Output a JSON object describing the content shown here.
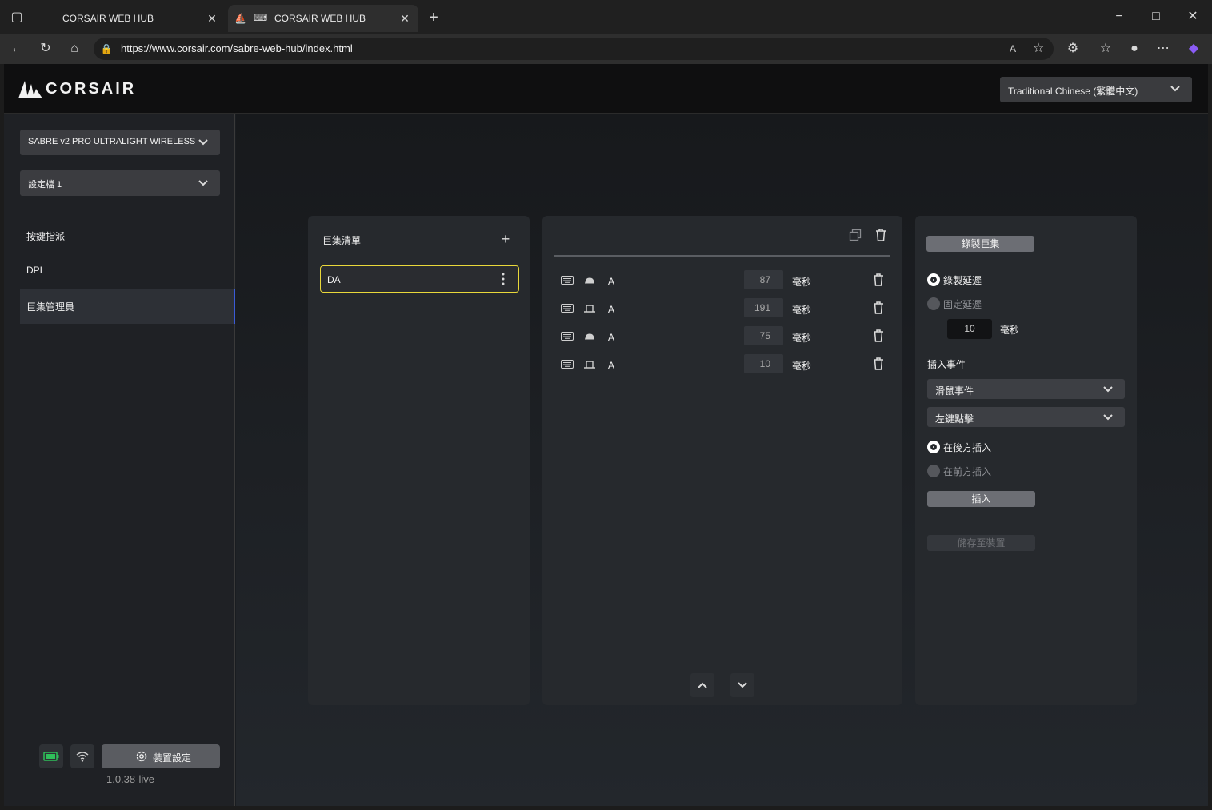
{
  "browser": {
    "tabs": [
      {
        "title": "CORSAIR WEB HUB"
      },
      {
        "title": "CORSAIR WEB HUB"
      }
    ],
    "url": "https://www.corsair.com/sabre-web-hub/index.html"
  },
  "header": {
    "brand": "CORSAIR",
    "language": "Traditional Chinese (繁體中文)"
  },
  "sidebar": {
    "device": "SABRE v2 PRO ULTRALIGHT WIRELESS",
    "profile": "設定檔 1",
    "nav": [
      {
        "label": "按鍵指派"
      },
      {
        "label": "DPI"
      },
      {
        "label": "巨集管理員"
      }
    ],
    "device_settings_label": "裝置設定",
    "version": "1.0.38-live"
  },
  "macro_list": {
    "title": "巨集清單",
    "items": [
      {
        "name": "DA"
      }
    ]
  },
  "events": {
    "rows": [
      {
        "key": "A",
        "action": "press",
        "delay": "87",
        "unit": "毫秒"
      },
      {
        "key": "A",
        "action": "release",
        "delay": "191",
        "unit": "毫秒"
      },
      {
        "key": "A",
        "action": "press",
        "delay": "75",
        "unit": "毫秒"
      },
      {
        "key": "A",
        "action": "release",
        "delay": "10",
        "unit": "毫秒"
      }
    ]
  },
  "settings": {
    "record_button": "錄製巨集",
    "record_delay_label": "錄製延遲",
    "fixed_delay_label": "固定延遲",
    "fixed_delay_value": "10",
    "fixed_delay_unit": "毫秒",
    "insert_event_title": "插入事件",
    "event_type": "滑鼠事件",
    "event_value": "左鍵點擊",
    "insert_after_label": "在後方插入",
    "insert_before_label": "在前方插入",
    "insert_button": "插入",
    "save_button": "儲存至裝置"
  },
  "colors": {
    "accent_selected": "#e9d83a",
    "nav_active_bar": "#3b5bd6",
    "battery_green": "#2fbf5a"
  }
}
